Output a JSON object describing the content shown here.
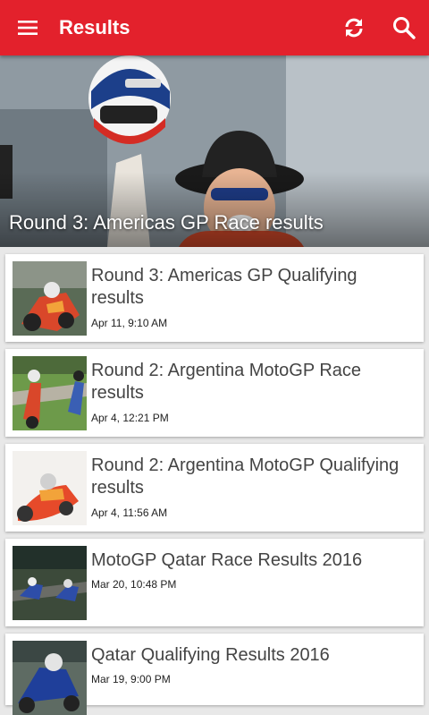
{
  "app_bar": {
    "title": "Results",
    "background": "#e3212c",
    "icons": [
      "menu-icon",
      "refresh-icon",
      "search-icon"
    ]
  },
  "hero": {
    "caption": "Round 3: Americas GP Race results",
    "image_subject": "rider in cowboy hat and sunglasses holding a helmet aloft"
  },
  "items": [
    {
      "title": "Round 3: Americas GP Qualifying results",
      "date": "Apr 11, 9:10 AM"
    },
    {
      "title": "Round 2: Argentina MotoGP Race results",
      "date": "Apr 4, 12:21 PM"
    },
    {
      "title": "Round 2: Argentina MotoGP Qualifying results",
      "date": "Apr 4, 11:56 AM"
    },
    {
      "title": "MotoGP Qatar Race Results 2016",
      "date": "Mar 20, 10:48 PM"
    },
    {
      "title": "Qatar Qualifying Results 2016",
      "date": "Mar 19, 9:00 PM"
    }
  ]
}
